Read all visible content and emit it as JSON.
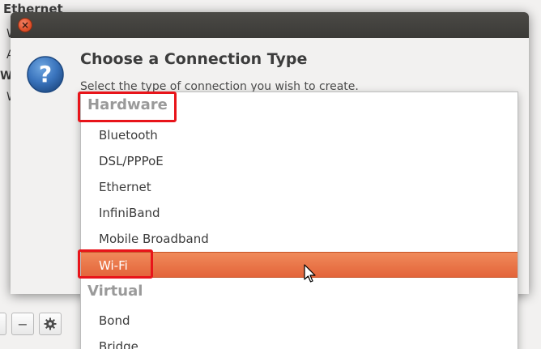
{
  "background_window": {
    "title": "Ethernet",
    "fragments": [
      "W",
      "A",
      "Wi",
      "W"
    ],
    "toolbar": {
      "remove_label": "−",
      "settings_icon": "gear-icon"
    }
  },
  "dialog": {
    "close_icon": "close-icon",
    "info_icon": "question-icon",
    "heading": "Choose a Connection Type",
    "subtext": "Select the type of connection you wish to create."
  },
  "menu": {
    "hardware_header": "Hardware",
    "hardware_items": [
      {
        "label": "Bluetooth"
      },
      {
        "label": "DSL/PPPoE"
      },
      {
        "label": "Ethernet"
      },
      {
        "label": "InfiniBand"
      },
      {
        "label": "Mobile Broadband"
      },
      {
        "label": "Wi-Fi",
        "selected": true
      }
    ],
    "virtual_header": "Virtual",
    "virtual_items": [
      {
        "label": "Bond"
      },
      {
        "label": "Bridge"
      }
    ]
  },
  "colors": {
    "selection": "#e8703f",
    "highlight_box": "#e8141a",
    "titlebar": "#3b3a37"
  }
}
